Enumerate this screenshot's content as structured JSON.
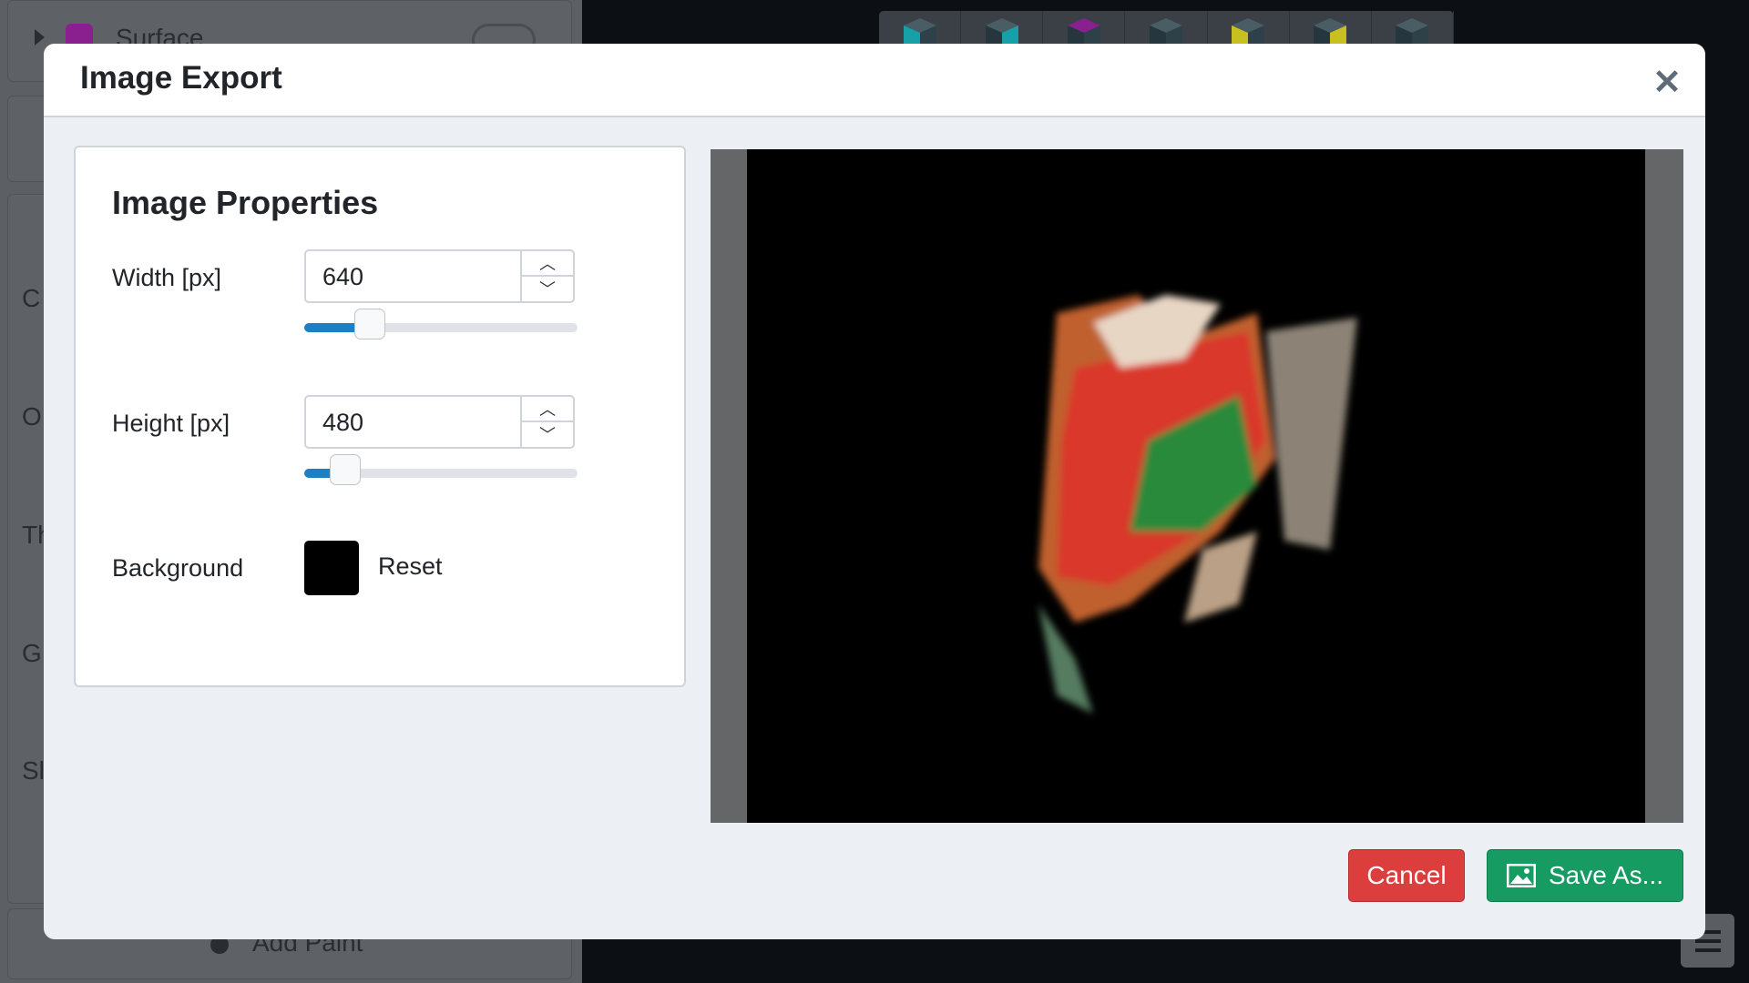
{
  "background_app": {
    "sidebar": {
      "layer_name": "Surface",
      "layer_color": "#8a1f8f",
      "clipped_labels": [
        "C",
        "O",
        "Th",
        "G",
        "Sl"
      ],
      "add_paint_label": "Add Paint"
    },
    "toolbar_icons": [
      "cube-teal-icon",
      "cube-cyan-icon",
      "cube-purple-icon",
      "cube-icon",
      "cube-yellow-icon",
      "cube-yellow-edge-icon",
      "cube-icon"
    ]
  },
  "modal": {
    "title": "Image Export",
    "close_icon": "close-icon",
    "properties": {
      "heading": "Image Properties",
      "width": {
        "label": "Width [px]",
        "value": "640",
        "slider_percent": 24
      },
      "height": {
        "label": "Height [px]",
        "value": "480",
        "slider_percent": 15
      },
      "background": {
        "label": "Background",
        "color": "#000000",
        "reset_label": "Reset"
      }
    },
    "buttons": {
      "cancel": "Cancel",
      "save": "Save As...",
      "save_icon": "image-icon"
    },
    "colors": {
      "cancel": "#dc3d3d",
      "save": "#169b62",
      "slider": "#1d7fc4"
    }
  }
}
